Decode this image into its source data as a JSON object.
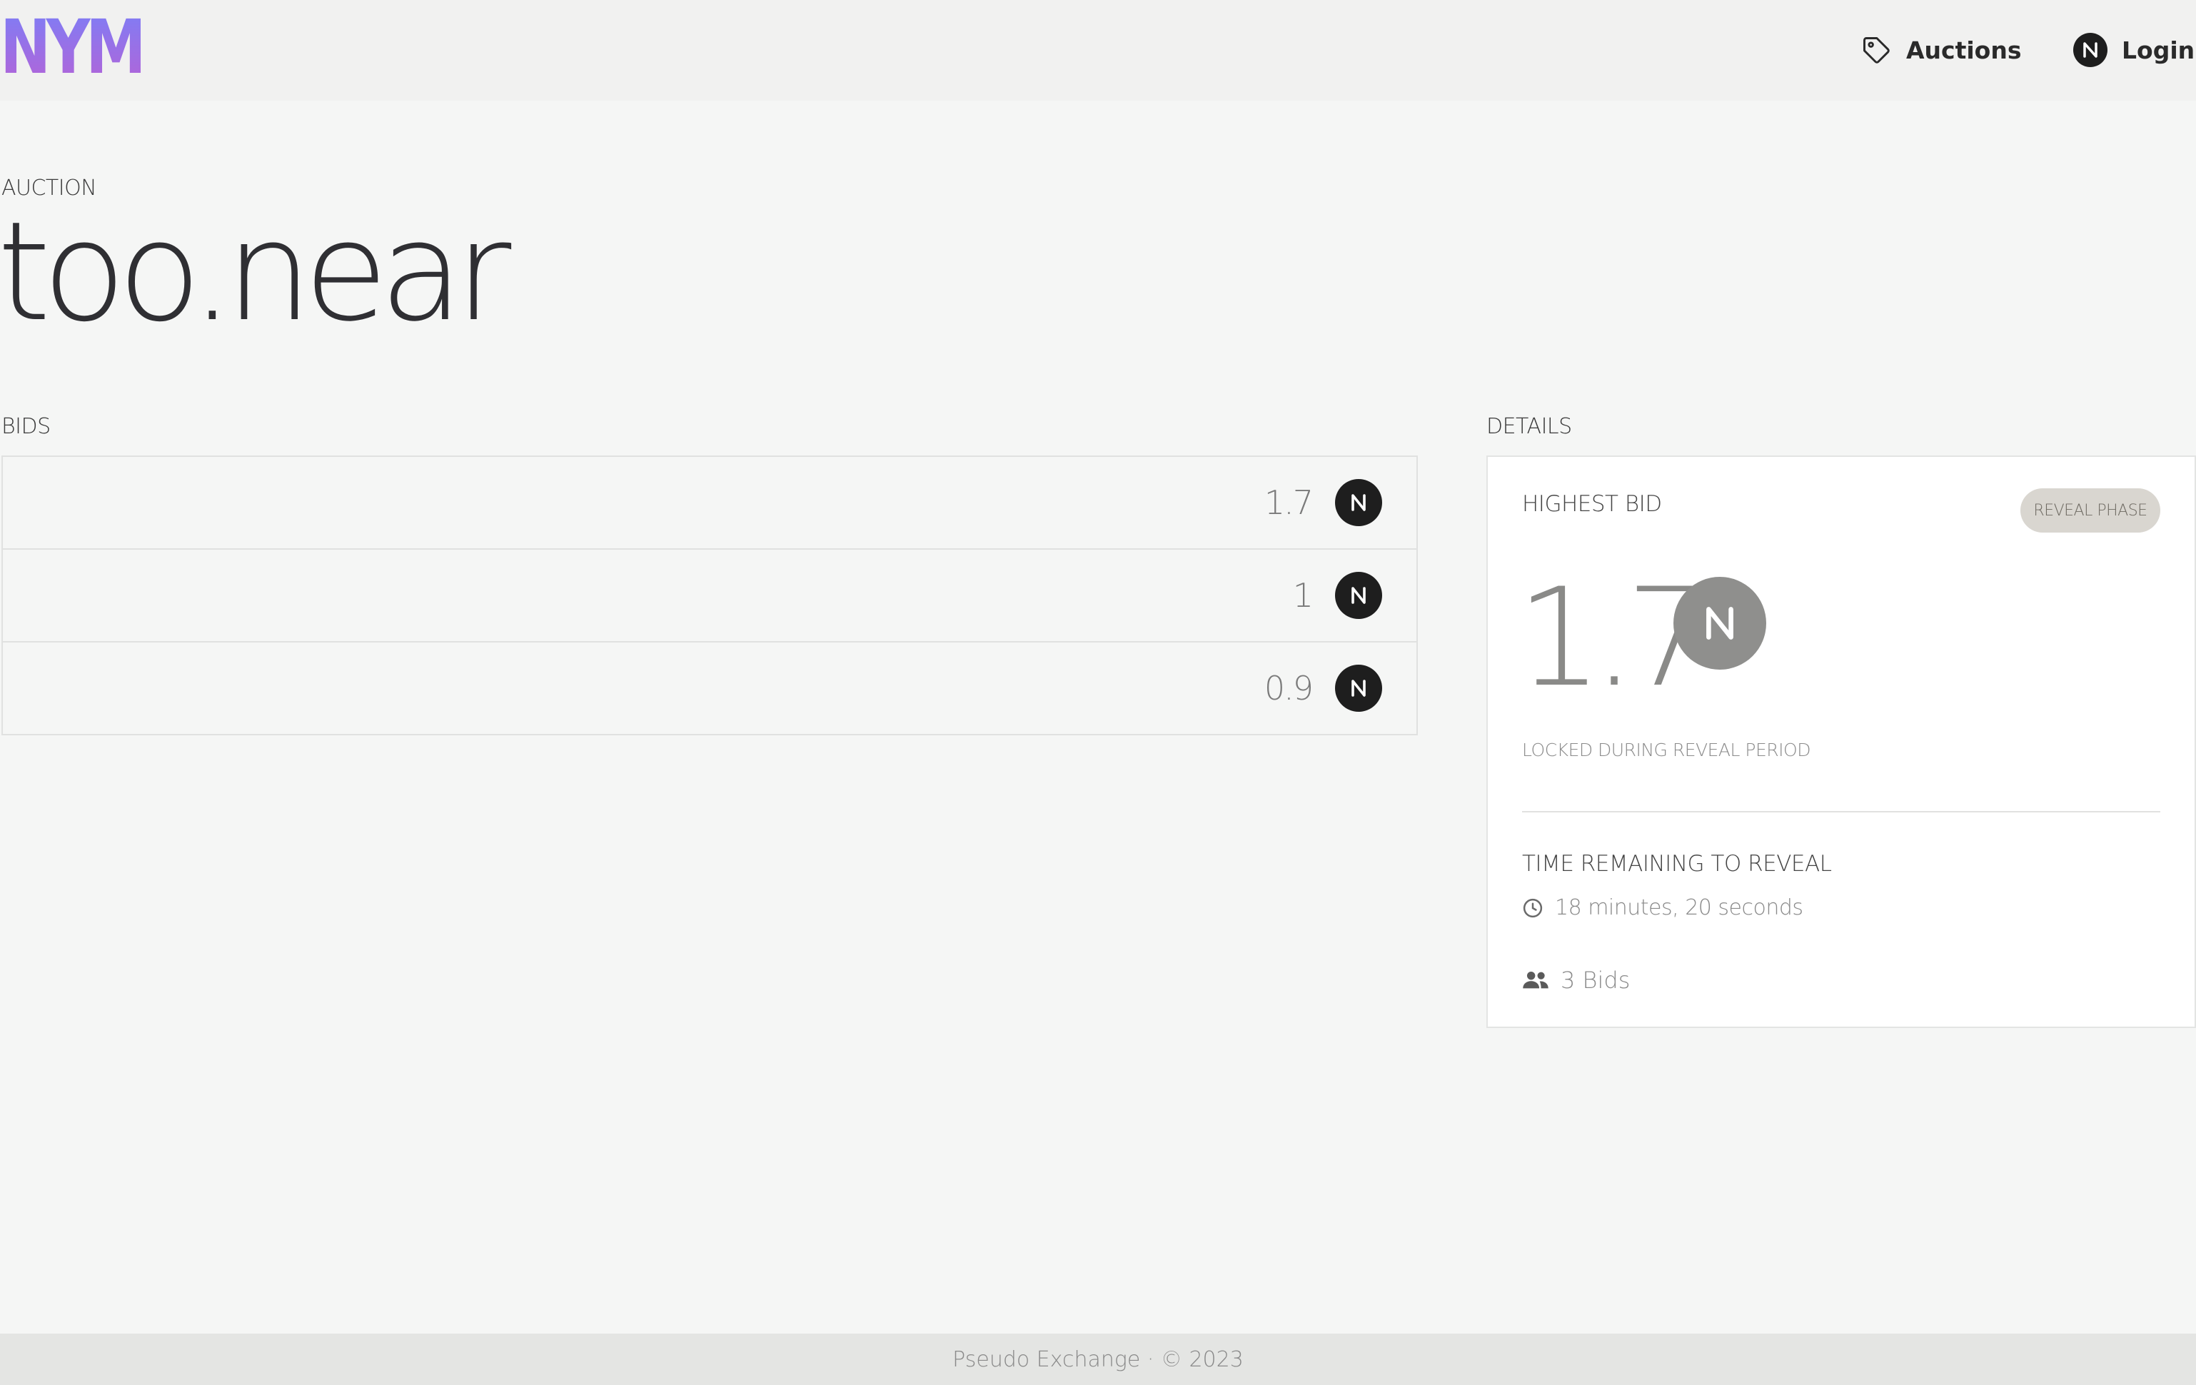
{
  "header": {
    "logo": "NYM",
    "nav": [
      {
        "label": "Auctions",
        "icon": "tag-icon"
      },
      {
        "label": "Login",
        "icon": "near-logo-icon"
      }
    ]
  },
  "auction": {
    "label": "AUCTION",
    "name": "too.near"
  },
  "bids": {
    "label": "BIDS",
    "rows": [
      {
        "amount": "1.7",
        "currency_icon": "near-logo-icon"
      },
      {
        "amount": "1",
        "currency_icon": "near-logo-icon"
      },
      {
        "amount": "0.9",
        "currency_icon": "near-logo-icon"
      }
    ]
  },
  "details": {
    "label": "DETAILS",
    "highest_bid_label": "HIGHEST BID",
    "phase": "REVEAL PHASE",
    "highest_bid_value": "1.7",
    "locked_note": "LOCKED DURING REVEAL PERIOD",
    "time_label": "TIME REMAINING TO REVEAL",
    "time_remaining": "18 minutes, 20 seconds",
    "bid_count": "3 Bids"
  },
  "footer": {
    "text": "Pseudo Exchange · © 2023"
  },
  "colors": {
    "logo_gradient_top": "#7f7df5",
    "logo_gradient_bottom": "#b264d8",
    "badge_bg": "#d9d6d0",
    "near_dark": "#1e1e1e"
  }
}
